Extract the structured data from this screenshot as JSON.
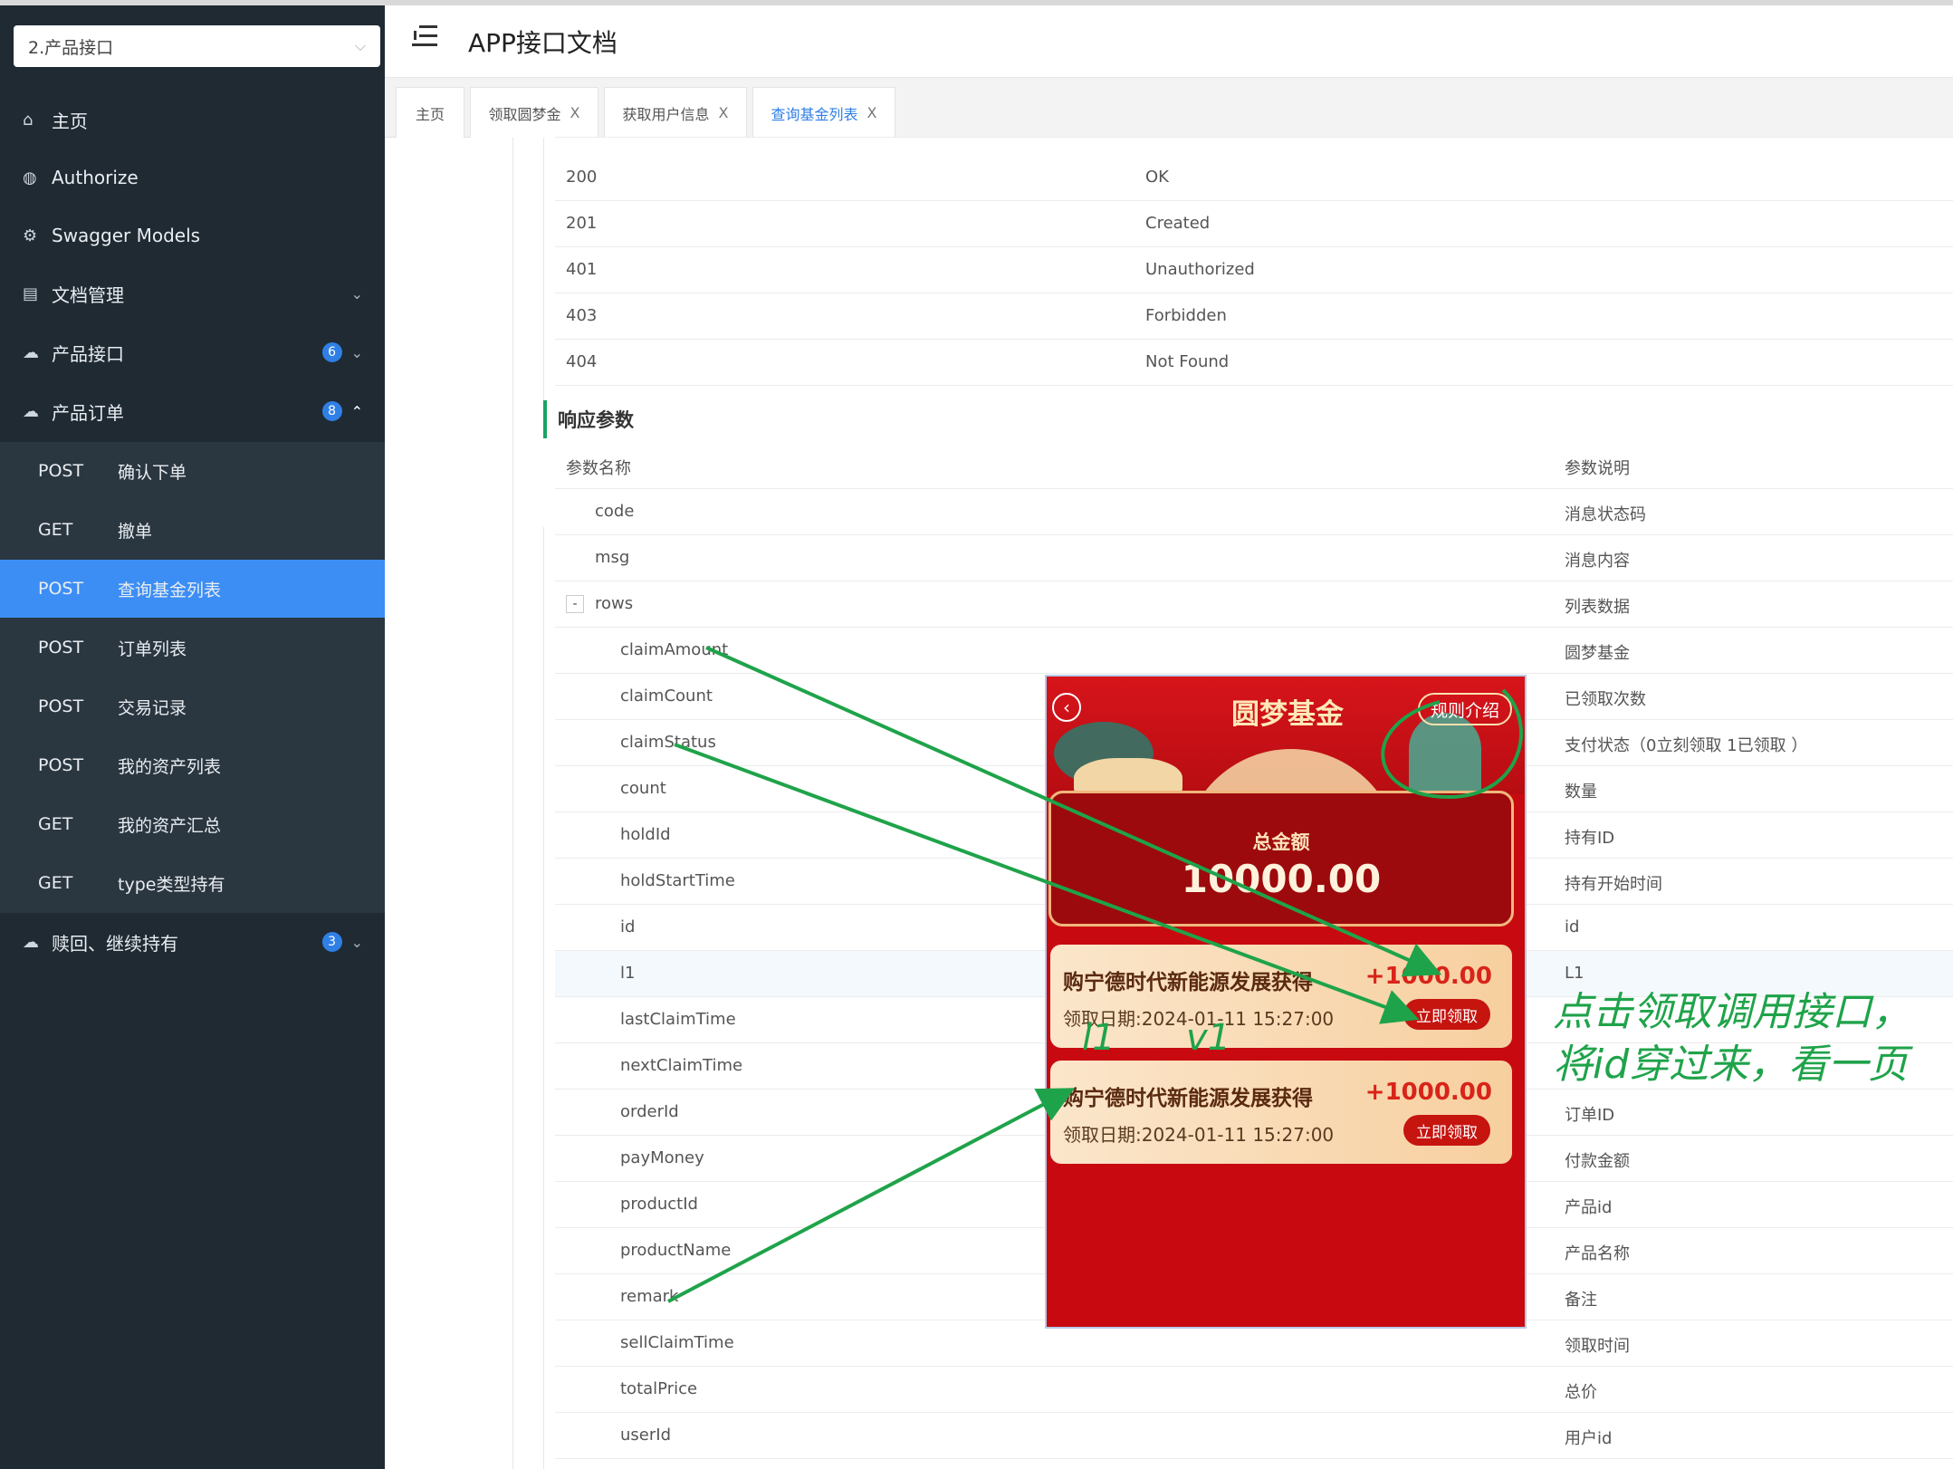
{
  "sidebar": {
    "group_select": "2.产品接口",
    "items": [
      {
        "label": "主页",
        "icon": "home-icon"
      },
      {
        "label": "Authorize",
        "icon": "lock-icon"
      },
      {
        "label": "Swagger Models",
        "icon": "cube-icon"
      },
      {
        "label": "文档管理",
        "icon": "docs-icon"
      },
      {
        "label": "产品接口",
        "icon": "cloud-icon",
        "badge": "6"
      },
      {
        "label": "产品订单",
        "icon": "cloud-icon",
        "badge": "8"
      },
      {
        "label": "赎回、继续持有",
        "icon": "cloud-icon",
        "badge": "3"
      }
    ],
    "subitems": [
      {
        "method": "POST",
        "name": "确认下单"
      },
      {
        "method": "GET",
        "name": "撤单"
      },
      {
        "method": "POST",
        "name": "查询基金列表"
      },
      {
        "method": "POST",
        "name": "订单列表"
      },
      {
        "method": "POST",
        "name": "交易记录"
      },
      {
        "method": "POST",
        "name": "我的资产列表"
      },
      {
        "method": "GET",
        "name": "我的资产汇总"
      },
      {
        "method": "GET",
        "name": "type类型持有"
      }
    ]
  },
  "header": {
    "title": "APP接口文档"
  },
  "tabs": [
    {
      "label": "主页"
    },
    {
      "label": "领取圆梦金",
      "close": "X"
    },
    {
      "label": "获取用户信息",
      "close": "X"
    },
    {
      "label": "查询基金列表",
      "close": "X"
    }
  ],
  "status_table": {
    "rows": [
      {
        "code": "200",
        "desc": "OK"
      },
      {
        "code": "201",
        "desc": "Created"
      },
      {
        "code": "401",
        "desc": "Unauthorized"
      },
      {
        "code": "403",
        "desc": "Forbidden"
      },
      {
        "code": "404",
        "desc": "Not Found"
      }
    ]
  },
  "response": {
    "section_title": "响应参数",
    "col_name": "参数名称",
    "col_desc": "参数说明",
    "toggle": "-",
    "params": [
      {
        "name": "code",
        "desc": "消息状态码"
      },
      {
        "name": "msg",
        "desc": "消息内容"
      },
      {
        "name": "rows",
        "desc": "列表数据"
      },
      {
        "name": "claimAmount",
        "desc": "圆梦基金"
      },
      {
        "name": "claimCount",
        "desc": "已领取次数"
      },
      {
        "name": "claimStatus",
        "desc": "支付状态（0立刻领取 1已领取 ）"
      },
      {
        "name": "count",
        "desc": "数量"
      },
      {
        "name": "holdId",
        "desc": "持有ID"
      },
      {
        "name": "holdStartTime",
        "desc": "持有开始时间"
      },
      {
        "name": "id",
        "desc": "id"
      },
      {
        "name": "l1",
        "desc": "L1"
      },
      {
        "name": "lastClaimTime",
        "desc": ""
      },
      {
        "name": "nextClaimTime",
        "desc": ""
      },
      {
        "name": "orderId",
        "desc": "订单ID"
      },
      {
        "name": "payMoney",
        "desc": "付款金额"
      },
      {
        "name": "productId",
        "desc": "产品id"
      },
      {
        "name": "productName",
        "desc": "产品名称"
      },
      {
        "name": "remark",
        "desc": "备注"
      },
      {
        "name": "sellClaimTime",
        "desc": "领取时间"
      },
      {
        "name": "totalPrice",
        "desc": "总价"
      },
      {
        "name": "userId",
        "desc": "用户id"
      }
    ]
  },
  "phone": {
    "back": "‹",
    "title": "圆梦基金",
    "rules": "规则介绍",
    "total_label": "总金额",
    "total_value": "10000.00",
    "cards": [
      {
        "name": "购宁德时代新能源发展获得",
        "amount": "+1000.00",
        "date": "领取日期:2024-01-11 15:27:00",
        "button": "立即领取"
      },
      {
        "name": "购宁德时代新能源发展获得",
        "amount": "+1000.00",
        "date": "领取日期:2024-01-11 15:27:00",
        "button": "立即领取"
      }
    ]
  },
  "annotations": {
    "note_line1": "点击领取调用接口，",
    "note_line2": "将id穿过来，看一页",
    "label_l1": "l1",
    "label_v1": "v1",
    "color": "#1fa34a"
  }
}
